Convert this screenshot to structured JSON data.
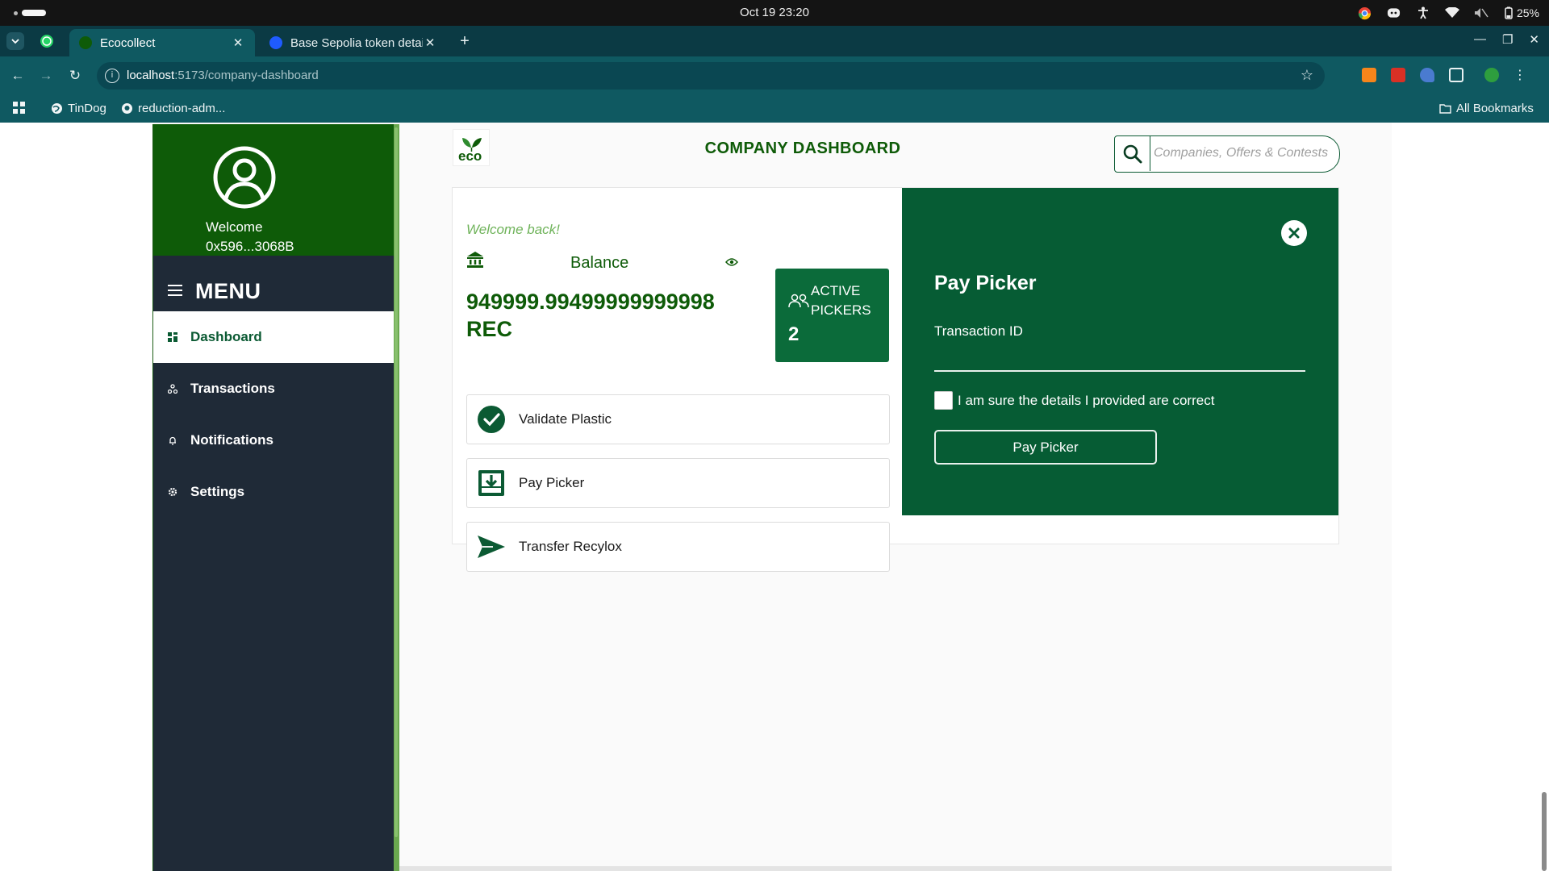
{
  "os": {
    "clock": "Oct 19  23:20",
    "battery": "25%"
  },
  "browser": {
    "tabs": [
      {
        "title": "Ecocollect",
        "active": true
      },
      {
        "title": "Base Sepolia token detai",
        "active": false
      }
    ],
    "url_host": "localhost",
    "url_path": ":5173/company-dashboard",
    "bookmarks": [
      {
        "label": "TinDog"
      },
      {
        "label": "reduction-adm..."
      }
    ],
    "all_bookmarks": "All Bookmarks"
  },
  "sidebar": {
    "welcome": "Welcome",
    "wallet": "0x596...3068B",
    "menu_title": "MENU",
    "items": [
      {
        "label": "Dashboard",
        "icon": "grid-icon",
        "active": true
      },
      {
        "label": "Transactions",
        "icon": "network-icon",
        "active": false
      },
      {
        "label": "Notifications",
        "icon": "bell-icon",
        "active": false
      },
      {
        "label": "Settings",
        "icon": "gear-icon",
        "active": false
      }
    ]
  },
  "header": {
    "logo_text": "eco",
    "title": "COMPANY DASHBOARD",
    "search_placeholder": "Companies, Offers & Contests"
  },
  "dashboard": {
    "welcome_back": "Welcome back!",
    "balance_label": "Balance",
    "balance_amount": "949999.99499999999998",
    "balance_unit": "REC",
    "active_pickers_label_1": "ACTIVE",
    "active_pickers_label_2": "PICKERS",
    "active_pickers_value": "2",
    "actions": [
      {
        "label": "Validate Plastic",
        "icon": "check-circle-icon"
      },
      {
        "label": "Pay Picker",
        "icon": "download-box-icon"
      },
      {
        "label": "Transfer Recylox",
        "icon": "send-icon"
      }
    ]
  },
  "pay_panel": {
    "title": "Pay Picker",
    "tx_label": "Transaction ID",
    "tx_value": "",
    "confirm_text": "I am sure the details I provided are correct",
    "submit_label": "Pay Picker"
  },
  "colors": {
    "brand_green": "#0e5b08",
    "panel_green": "#065c34",
    "sidebar_bg": "#1f2a37",
    "accent_light_green": "#6fb35a"
  }
}
